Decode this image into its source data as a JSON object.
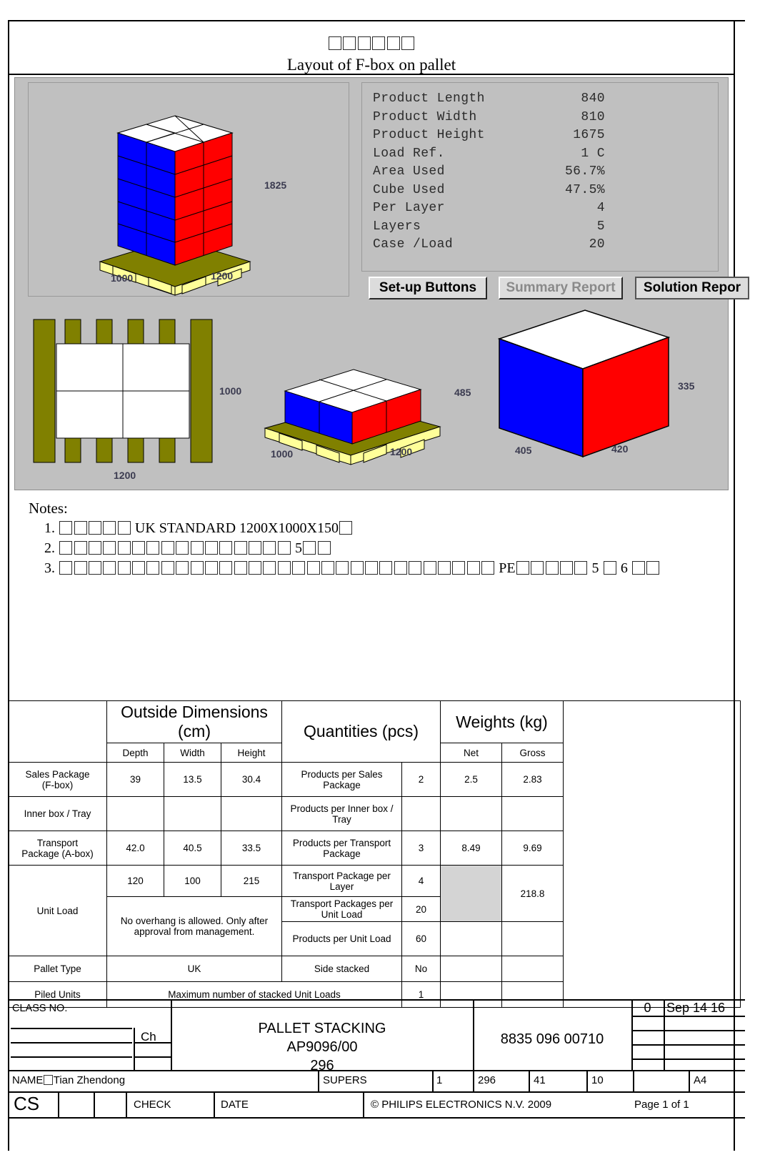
{
  "header": {
    "cjk_title_boxes": 6,
    "english_title": "Layout of F-box on pallet"
  },
  "app_panel": {
    "info": [
      {
        "label": "Product Length",
        "value": "840"
      },
      {
        "label": "Product Width",
        "value": "810"
      },
      {
        "label": "Product Height",
        "value": "1675"
      },
      {
        "label": "Load Ref.",
        "value": "1 C"
      },
      {
        "label": "Area Used",
        "value": "56.7%"
      },
      {
        "label": "Cube Used",
        "value": "47.5%"
      },
      {
        "label": "Per Layer",
        "value": "4"
      },
      {
        "label": "Layers",
        "value": "5"
      },
      {
        "label": "Case /Load",
        "value": "20"
      }
    ],
    "buttons": [
      {
        "label": "Set-up Buttons",
        "state": "enabled"
      },
      {
        "label": "Summary Report",
        "state": "disabled"
      },
      {
        "label": "Solution Repor",
        "state": "focused"
      }
    ],
    "dimensions": {
      "pallet_stack_height": "1825",
      "pallet_stack_depth": "1000",
      "pallet_stack_width": "1200",
      "footprint_depth": "1000",
      "footprint_width": "1200",
      "layer_height": "485",
      "layer_depth": "1000",
      "layer_width": "1200",
      "box_height": "335",
      "box_depth": "405",
      "box_width": "420"
    },
    "colors": {
      "panel_bg": "#c0c0c0",
      "box_blue": "#0000ff",
      "box_red": "#ff0000",
      "box_top": "#ffffff",
      "pallet_dark": "#808000",
      "pallet_light": "#ffff99"
    }
  },
  "notes": {
    "heading": "Notes:",
    "items": [
      {
        "number": "1.",
        "tofu_before": 5,
        "text": "UK STANDARD 1200X1000X150",
        "tofu_after": 1
      },
      {
        "number": "2.",
        "tofu_before": 16,
        "text": "5",
        "tofu_after": 2
      },
      {
        "number": "3.",
        "tofu_before": 30,
        "text": "PE",
        "tofu_mid": 5,
        "text2": "5",
        "tofu_mid2": 1,
        "text3": "6",
        "tofu_after": 2
      }
    ]
  },
  "spec_table": {
    "group_headers": {
      "outside_dimensions": "Outside Dimensions (cm)",
      "quantities": "Quantities (pcs)",
      "weights": "Weights (kg)"
    },
    "sub_headers": {
      "depth": "Depth",
      "width": "Width",
      "height": "Height",
      "net": "Net",
      "gross": "Gross"
    },
    "rows": [
      {
        "label": "Sales Package\n(F-box)",
        "depth": "39",
        "width": "13.5",
        "height": "30.4",
        "qty_label": "Products per Sales Package",
        "qty": "2",
        "net": "2.5",
        "gross": "2.83"
      },
      {
        "label": "Inner box / Tray",
        "depth": "",
        "width": "",
        "height": "",
        "qty_label": "Products per Inner box / Tray",
        "qty": "",
        "net": "",
        "gross": ""
      },
      {
        "label": "Transport\nPackage (A-box)",
        "depth": "42.0",
        "width": "40.5",
        "height": "33.5",
        "qty_label": "Products per Transport Package",
        "qty": "3",
        "net": "8.49",
        "gross": "9.69"
      }
    ],
    "unit_load": {
      "label": "Unit Load",
      "depth": "120",
      "width": "100",
      "height": "215",
      "overhang_note": "No overhang is allowed. Only after approval from management.",
      "quantities": [
        {
          "label": "Transport Package per Layer",
          "value": "4"
        },
        {
          "label": "Transport Packages per Unit Load",
          "value": "20"
        },
        {
          "label": "Products per Unit Load",
          "value": "60"
        }
      ],
      "gross": "218.8"
    },
    "pallet_type": {
      "label": "Pallet Type",
      "value": "UK",
      "side_label": "Side stacked",
      "side_value": "No"
    },
    "piled_units": {
      "label": "Piled Units",
      "value": "Maximum number of stacked Unit Loads",
      "count": "1"
    }
  },
  "title_block": {
    "class_no": "CLASS NO.",
    "ch": "Ch",
    "drawing_title": "PALLET STACKING",
    "drawing_code": "AP9096/00",
    "drawing_sub": "296",
    "part_number": "8835 096 00710",
    "revision": "0",
    "date": "Sep 14 16",
    "name_label": "NAME",
    "name_value": "Tian Zhendong",
    "supers": "SUPERS",
    "col_1": "1",
    "col_296": "296",
    "col_41": "41",
    "col_10": "10",
    "format": "A4",
    "cs": "CS",
    "check": "CHECK",
    "date_label": "DATE",
    "copyright": "© PHILIPS ELECTRONICS N.V. 2009",
    "page": "Page 1 of 1"
  }
}
